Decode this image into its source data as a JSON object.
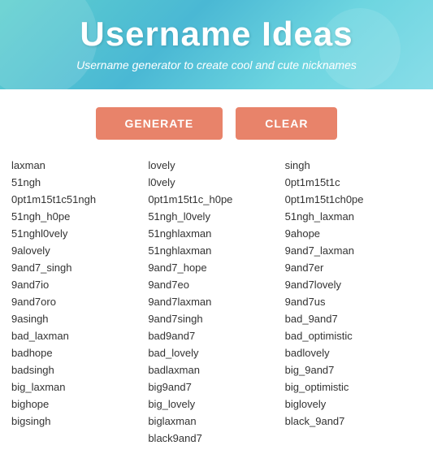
{
  "header": {
    "title": "Username Ideas",
    "subtitle": "Username generator to create cool and cute nicknames"
  },
  "buttons": {
    "generate": "GENERATE",
    "clear": "CLEAR"
  },
  "columns": [
    [
      "laxman",
      "51ngh",
      "0pt1m15t1c51ngh",
      "51ngh_h0pe",
      "51nghl0vely",
      "9alovely",
      "9and7_singh",
      "9and7io",
      "9and7oro",
      "9asingh",
      "bad_laxman",
      "badhope",
      "badsingh",
      "big_laxman",
      "bighope",
      "bigsingh"
    ],
    [
      "lovely",
      "l0vely",
      "0pt1m15t1c_h0pe",
      "51ngh_l0vely",
      "51nghlaxman",
      "51nghlaxman",
      "9and7_hope",
      "9and7eo",
      "9and7laxman",
      "9and7singh",
      "bad9and7",
      "bad_lovely",
      "badlaxman",
      "big9and7",
      "big_lovely",
      "biglaxman",
      "black9and7"
    ],
    [
      "singh",
      "0pt1m15t1c",
      "0pt1m15t1ch0pe",
      "51ngh_laxman",
      "9ahope",
      "9and7_laxman",
      "9and7er",
      "9and7lovely",
      "9and7us",
      "bad_9and7",
      "bad_optimistic",
      "badlovely",
      "big_9and7",
      "big_optimistic",
      "biglovely",
      "black_9and7"
    ]
  ]
}
